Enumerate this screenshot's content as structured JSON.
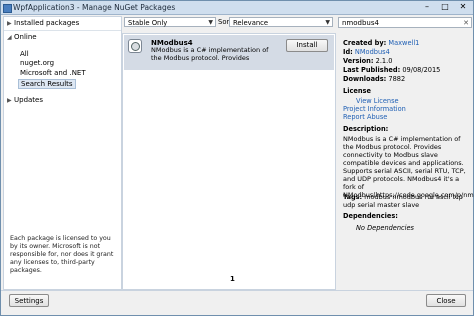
{
  "window": {
    "title": "WpfApplication3 - Manage NuGet Packages",
    "controls": {
      "minimize": "–",
      "maximize": "□",
      "close": "✕"
    }
  },
  "left": {
    "installed": "Installed packages",
    "online": "Online",
    "online_children": [
      "All",
      "nuget.org",
      "Microsoft and .NET",
      "Search Results"
    ],
    "selected_child": "Search Results",
    "updates": "Updates",
    "notice": "Each package is licensed to you by its owner. Microsoft is not responsible for, nor does it grant any licenses to, third-party packages."
  },
  "filters": {
    "release": "Stable Only",
    "sort_label": "Sort by:",
    "sort": "Relevance"
  },
  "search": {
    "value": "nmodbus4",
    "clear": "✕"
  },
  "results": [
    {
      "name": "NModbus4",
      "description": "NModbus is a C# implementation of the Modbus protocol. Provides connectivity to ...",
      "action": "Install"
    }
  ],
  "pager": "1",
  "details": {
    "created_by_label": "Created by:",
    "created_by": "Maxwell1",
    "id_label": "Id:",
    "id": "NModbus4",
    "version_label": "Version:",
    "version": "2.1.0",
    "last_published_label": "Last Published:",
    "last_published": "09/08/2015",
    "downloads_label": "Downloads:",
    "downloads": "7882",
    "license_label": "License",
    "links": [
      "View License",
      "Project Information",
      "Report Abuse"
    ],
    "description_label": "Description:",
    "description": "NModbus is a C# implementation of the Modbus protocol. Provides connectivity to Modbus slave compatible devices and applications. Supports serial ASCII, serial RTU, TCP, and UDP protocols. NModbus4 it's a fork of NModbus(https://code.google.com/p/nmodbus)",
    "tags_label": "Tags:",
    "tags": "modbus nmodbus rtu ascii tcp udp serial master slave",
    "dependencies_label": "Dependencies:",
    "dependencies": "No Dependencies"
  },
  "buttons": {
    "settings": "Settings",
    "close": "Close"
  },
  "colors": {
    "selected_row": "#d4dbe5",
    "link": "#1f5fb4",
    "titlebar": "#cfdeee"
  }
}
